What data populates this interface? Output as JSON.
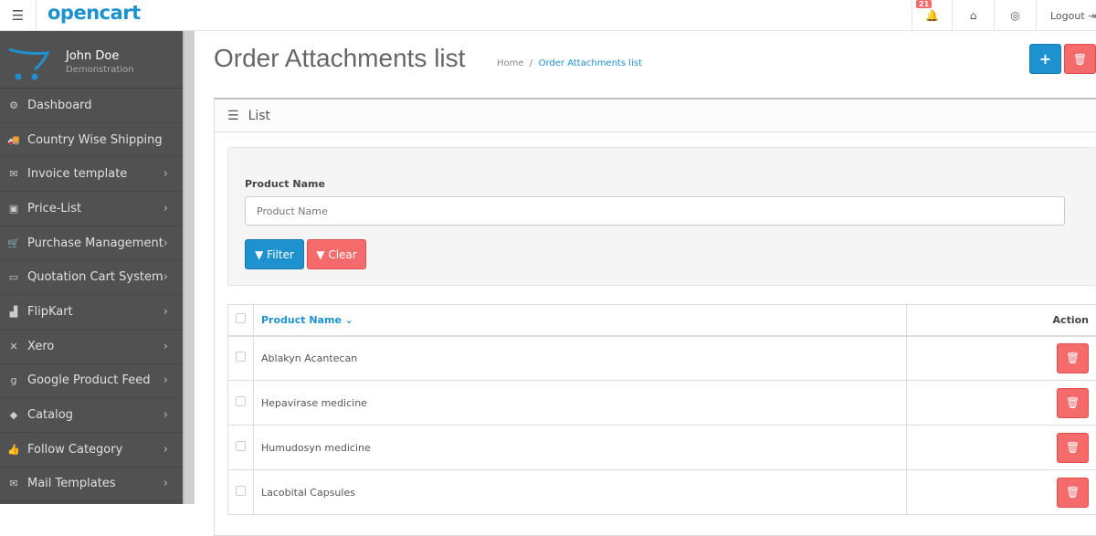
{
  "header": {
    "logo": "opencart",
    "notifications": "21",
    "logout": "Logout"
  },
  "user": {
    "name": "John Doe",
    "role": "Demonstration"
  },
  "sidebar": {
    "items": [
      {
        "label": "Dashboard",
        "icon": "⚙",
        "chev": ""
      },
      {
        "label": "Country Wise Shipping",
        "icon": "🚚",
        "chev": ""
      },
      {
        "label": "Invoice template",
        "icon": "✉",
        "chev": "›"
      },
      {
        "label": "Price-List",
        "icon": "▣",
        "chev": "›"
      },
      {
        "label": "Purchase Management",
        "icon": "🛒",
        "chev": "›"
      },
      {
        "label": "Quotation Cart System",
        "icon": "▭",
        "chev": "›"
      },
      {
        "label": "FlipKart",
        "icon": "▟",
        "chev": "›"
      },
      {
        "label": "Xero",
        "icon": "✕",
        "chev": "›"
      },
      {
        "label": "Google Product Feed",
        "icon": "g",
        "chev": "›"
      },
      {
        "label": "Catalog",
        "icon": "◆",
        "chev": "›"
      },
      {
        "label": "Follow Category",
        "icon": "👍",
        "chev": "›"
      },
      {
        "label": "Mail Templates",
        "icon": "✉",
        "chev": "›"
      }
    ]
  },
  "page": {
    "title": "Order Attachments list",
    "breadcrumb_home": "Home",
    "breadcrumb_current": "Order Attachments list"
  },
  "panel": {
    "title": "List"
  },
  "filter": {
    "label": "Product Name",
    "placeholder": "Product Name",
    "filter_btn": "Filter",
    "clear_btn": "Clear"
  },
  "table": {
    "col_name": "Product Name",
    "col_action": "Action",
    "rows": [
      "Ablakyn Acantecan",
      "Hepavirase medicine",
      "Humudosyn medicine",
      "Lacobital Capsules"
    ]
  }
}
